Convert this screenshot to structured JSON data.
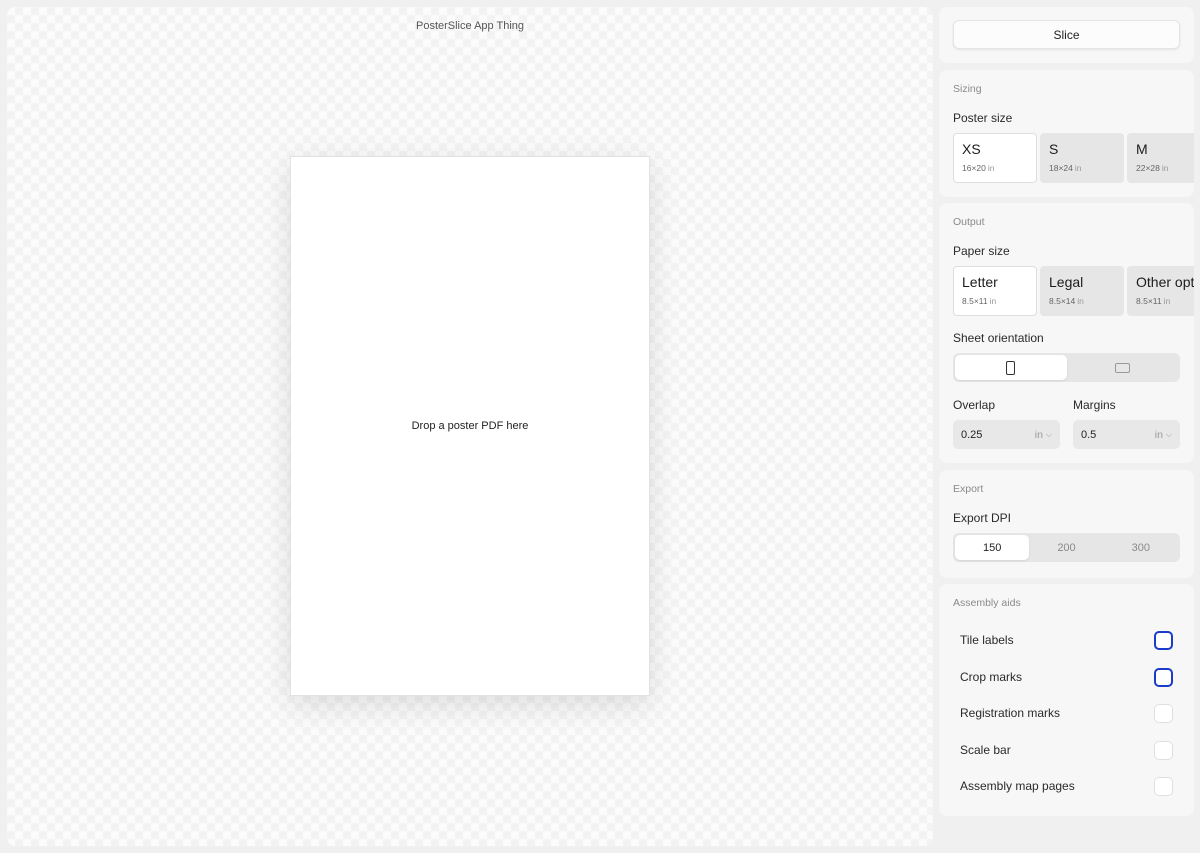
{
  "app_title": "PosterSlice App Thing",
  "drop_text": "Drop a poster PDF here",
  "slice_label": "Slice",
  "sizing": {
    "title": "Sizing",
    "poster_size_label": "Poster size",
    "options": [
      {
        "name": "XS",
        "dims": "16×20",
        "unit": "in",
        "selected": true
      },
      {
        "name": "S",
        "dims": "18×24",
        "unit": "in",
        "selected": false
      },
      {
        "name": "M",
        "dims": "22×28",
        "unit": "in",
        "selected": false
      }
    ]
  },
  "output": {
    "title": "Output",
    "paper_size_label": "Paper size",
    "options": [
      {
        "name": "Letter",
        "dims": "8.5×11",
        "unit": "in",
        "selected": true
      },
      {
        "name": "Legal",
        "dims": "8.5×14",
        "unit": "in",
        "selected": false
      },
      {
        "name": "Other opt",
        "dims": "8.5×11",
        "unit": "in",
        "selected": false
      }
    ],
    "orientation_label": "Sheet orientation",
    "orientation_selected": "portrait",
    "orientation_icons": [
      "portrait-sheet-icon",
      "landscape-sheet-icon"
    ],
    "overlap_label": "Overlap",
    "overlap_value": "0.25",
    "overlap_unit": "in",
    "margins_label": "Margins",
    "margins_value": "0.5",
    "margins_unit": "in"
  },
  "export": {
    "title": "Export",
    "dpi_label": "Export DPI",
    "options": [
      "150",
      "200",
      "300"
    ],
    "selected": "150"
  },
  "assembly": {
    "title": "Assembly aids",
    "items": [
      {
        "label": "Tile labels",
        "checked": true
      },
      {
        "label": "Crop marks",
        "checked": true
      },
      {
        "label": "Registration marks",
        "checked": false
      },
      {
        "label": "Scale bar",
        "checked": false
      },
      {
        "label": "Assembly map pages",
        "checked": false
      }
    ]
  },
  "colors": {
    "accent": "#1a3cc9",
    "panel": "#f7f7f7",
    "background": "#f0f0f0"
  }
}
